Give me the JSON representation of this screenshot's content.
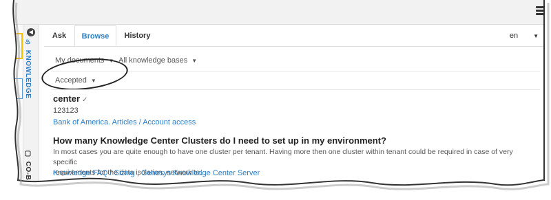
{
  "header": {
    "menu_icon": "hamburger-menu-icon"
  },
  "rail": {
    "collapse_icon": "chevron-left-icon",
    "knowledge_label": "KNOWLEDGE",
    "cobrowse_label": "CO-B"
  },
  "tabs": [
    {
      "label": "Ask"
    },
    {
      "label": "Browse"
    },
    {
      "label": "History"
    }
  ],
  "language": {
    "value": "en"
  },
  "filters": {
    "documents": "My documents",
    "knowledge_bases": "All knowledge bases",
    "status": "Accepted"
  },
  "results": [
    {
      "title": "center",
      "meta": "123123",
      "link": "Bank of America. Articles / Account access"
    },
    {
      "title": "How many Knowledge Center Clusters do I need to set up in my environment?",
      "snippet_line1": "In most cases you are quite enough to have one cluster per tenant. Having more then one cluster within tenant could be required in case of very specific",
      "snippet_line2": "requirements for the data isolation, network to...",
      "link_a": "Knowledge FAQ / Sizing",
      "link_sep": ",",
      "link_b": "Genesys Knowledge Center Server"
    }
  ],
  "colors": {
    "accent": "#2d7ec4",
    "highlight": "#f2c400"
  }
}
